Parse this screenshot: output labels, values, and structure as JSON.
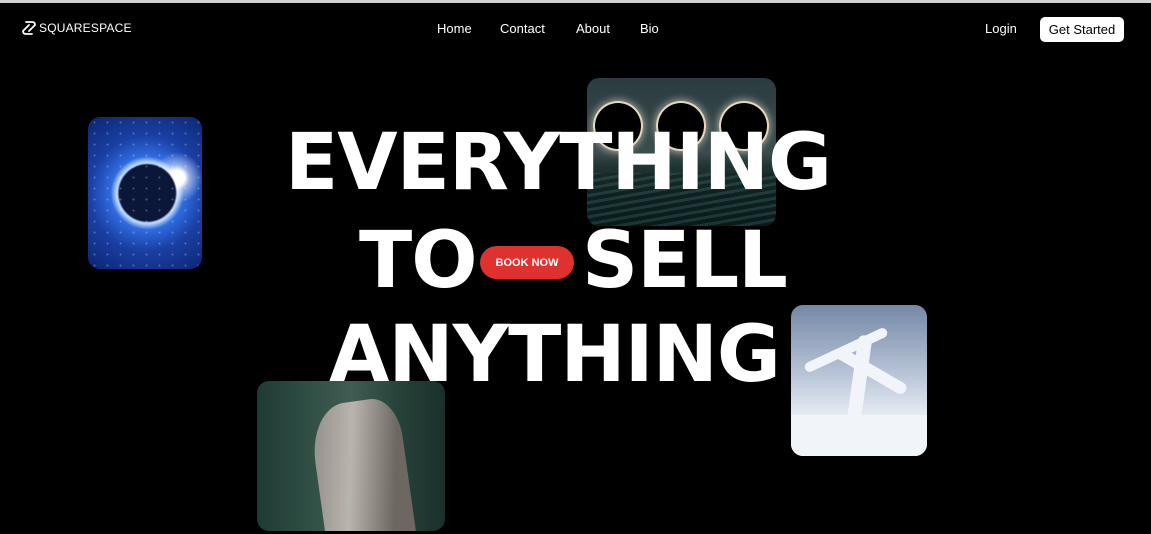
{
  "brand": {
    "name": "SQUARESPACE",
    "logo_icon": "squarespace-logo-icon"
  },
  "nav": {
    "items": [
      "Home",
      "Contact",
      "About",
      "Bio"
    ]
  },
  "header_actions": {
    "login": "Login",
    "get_started": "Get Started"
  },
  "hero": {
    "line1": "EVERYTHING",
    "line2a": "TO",
    "line2b": "SELL",
    "line3": "ANYTHING",
    "cta": "BOOK NOW"
  },
  "colors": {
    "background": "#000000",
    "cta": "#e03131",
    "text": "#ffffff"
  },
  "images": [
    "eclipse-image",
    "sea-eclipses-image",
    "snowy-tree-image",
    "forest-trunk-image"
  ]
}
